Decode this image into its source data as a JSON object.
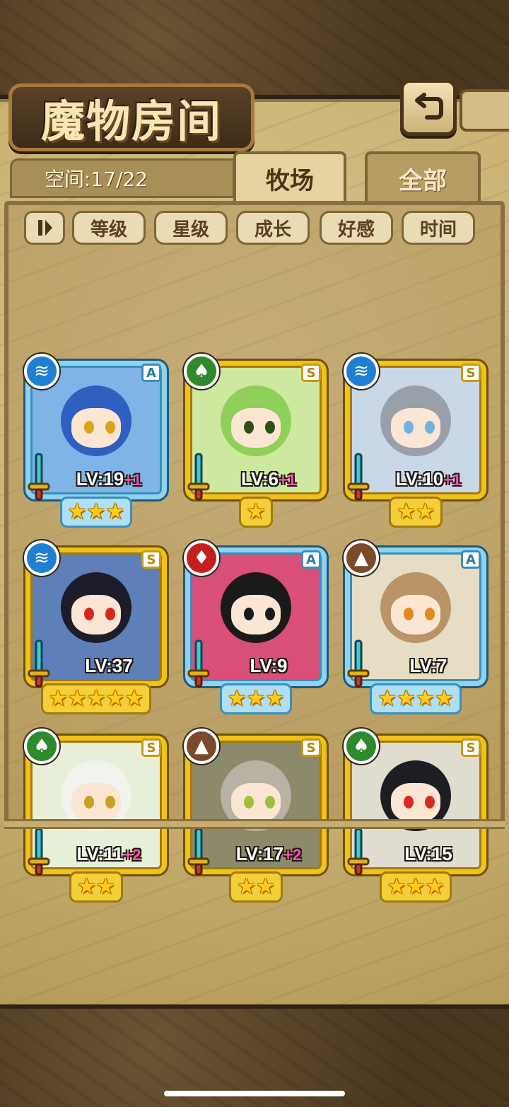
{
  "header": {
    "title": "魔物房间",
    "back_icon": "back-arrow-icon"
  },
  "status": {
    "space_text": "空间:17/22"
  },
  "tabs": [
    {
      "label": "牧场",
      "active": true
    },
    {
      "label": "全部",
      "active": false
    }
  ],
  "sort_bar": {
    "toggle_icon": "pause-sort-icon",
    "buttons": [
      "等级",
      "星级",
      "成长",
      "好感",
      "时间"
    ]
  },
  "monsters": [
    {
      "element": "water",
      "rank": "A",
      "frame": "blue",
      "level": "LV:19",
      "bonus": "+1",
      "stars": 3,
      "hair_color": "#2f5fbf",
      "eye_color": "#d9a417",
      "bg": "#7fb4e6"
    },
    {
      "element": "nature",
      "rank": "S",
      "frame": "gold",
      "level": "LV:6",
      "bonus": "+1",
      "stars": 1,
      "hair_color": "#8fcf5a",
      "eye_color": "#2f4f1a",
      "bg": "#cfe8a0"
    },
    {
      "element": "water",
      "rank": "S",
      "frame": "gold",
      "level": "LV:10",
      "bonus": "+1",
      "stars": 2,
      "hair_color": "#9aa0aa",
      "eye_color": "#6fb3e0",
      "bg": "#c9d7e6"
    },
    {
      "element": "water",
      "rank": "S",
      "frame": "gold",
      "level": "LV:37",
      "bonus": "",
      "stars": 5,
      "hair_color": "#1c1c2a",
      "eye_color": "#d8261f",
      "bg": "#5e7fb8"
    },
    {
      "element": "fire",
      "rank": "A",
      "frame": "blue",
      "level": "LV:9",
      "bonus": "",
      "stars": 3,
      "hair_color": "#1a1a1a",
      "eye_color": "#1a1a1a",
      "bg": "#d94f78"
    },
    {
      "element": "earth",
      "rank": "A",
      "frame": "blue",
      "level": "LV:7",
      "bonus": "",
      "stars": 4,
      "hair_color": "#b89466",
      "eye_color": "#e08b1f",
      "bg": "#e7dcc4"
    },
    {
      "element": "nature",
      "rank": "S",
      "frame": "gold",
      "level": "LV:11",
      "bonus": "+2",
      "stars": 2,
      "hair_color": "#f3f3ee",
      "eye_color": "#c9a021",
      "bg": "#e8efd8"
    },
    {
      "element": "earth",
      "rank": "S",
      "frame": "gold",
      "level": "LV:17",
      "bonus": "+2",
      "stars": 2,
      "hair_color": "#b8b2a4",
      "eye_color": "#9ac23a",
      "bg": "#8c8a6a"
    },
    {
      "element": "nature",
      "rank": "S",
      "frame": "gold",
      "level": "LV:15",
      "bonus": "",
      "stars": 3,
      "hair_color": "#1d1d24",
      "eye_color": "#d82a22",
      "bg": "#e0dccf"
    }
  ]
}
